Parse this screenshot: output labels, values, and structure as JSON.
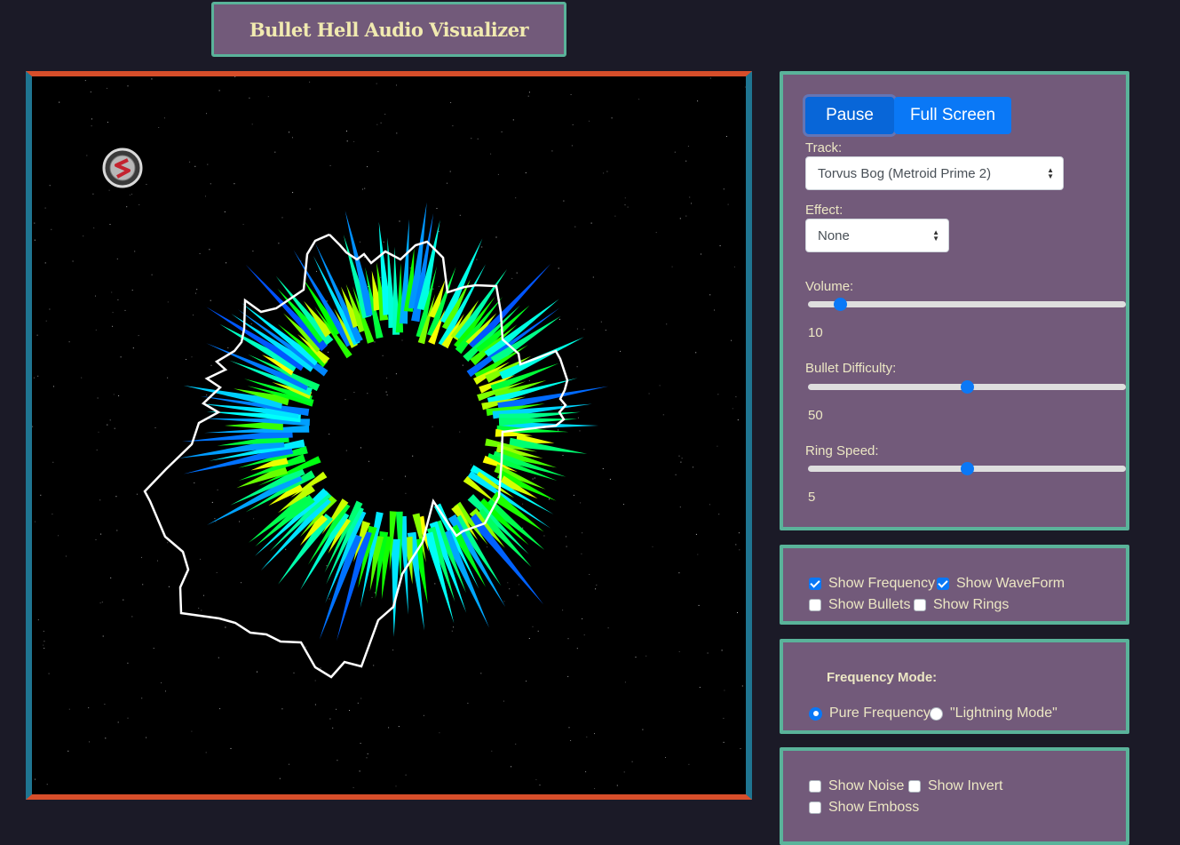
{
  "header": {
    "title": "Bullet Hell Audio Visualizer"
  },
  "controls": {
    "pause_label": "Pause",
    "fullscreen_label": "Full Screen",
    "track_label": "Track:",
    "track_value": "Torvus Bog (Metroid Prime 2)",
    "effect_label": "Effect:",
    "effect_value": "None",
    "volume": {
      "label": "Volume:",
      "value": "10",
      "fraction": 0.1
    },
    "difficulty": {
      "label": "Bullet Difficulty:",
      "value": "50",
      "fraction": 0.5
    },
    "ring_speed": {
      "label": "Ring Speed:",
      "value": "5",
      "fraction": 0.5
    }
  },
  "display_options": {
    "show_frequency": {
      "label": "Show Frequency",
      "checked": true
    },
    "show_waveform": {
      "label": "Show WaveForm",
      "checked": true
    },
    "show_bullets": {
      "label": "Show Bullets",
      "checked": false
    },
    "show_rings": {
      "label": "Show Rings",
      "checked": false
    }
  },
  "frequency_mode": {
    "heading": "Frequency Mode:",
    "pure_label": "Pure Frequency",
    "lightning_label": "\"Lightning Mode\"",
    "selected": "pure"
  },
  "filters": {
    "show_noise": {
      "label": "Show Noise",
      "checked": false
    },
    "show_invert": {
      "label": "Show Invert",
      "checked": false
    },
    "show_emboss": {
      "label": "Show Emboss",
      "checked": false
    }
  },
  "colors": {
    "accent": "#0a78f6",
    "panel": "#725a7a",
    "panel_border": "#5ab39a",
    "frame_top": "#d74e2a",
    "frame_side": "#1f7591",
    "page_bg": "#1b1a27"
  },
  "icons": {
    "player_ship": "ship-icon"
  }
}
